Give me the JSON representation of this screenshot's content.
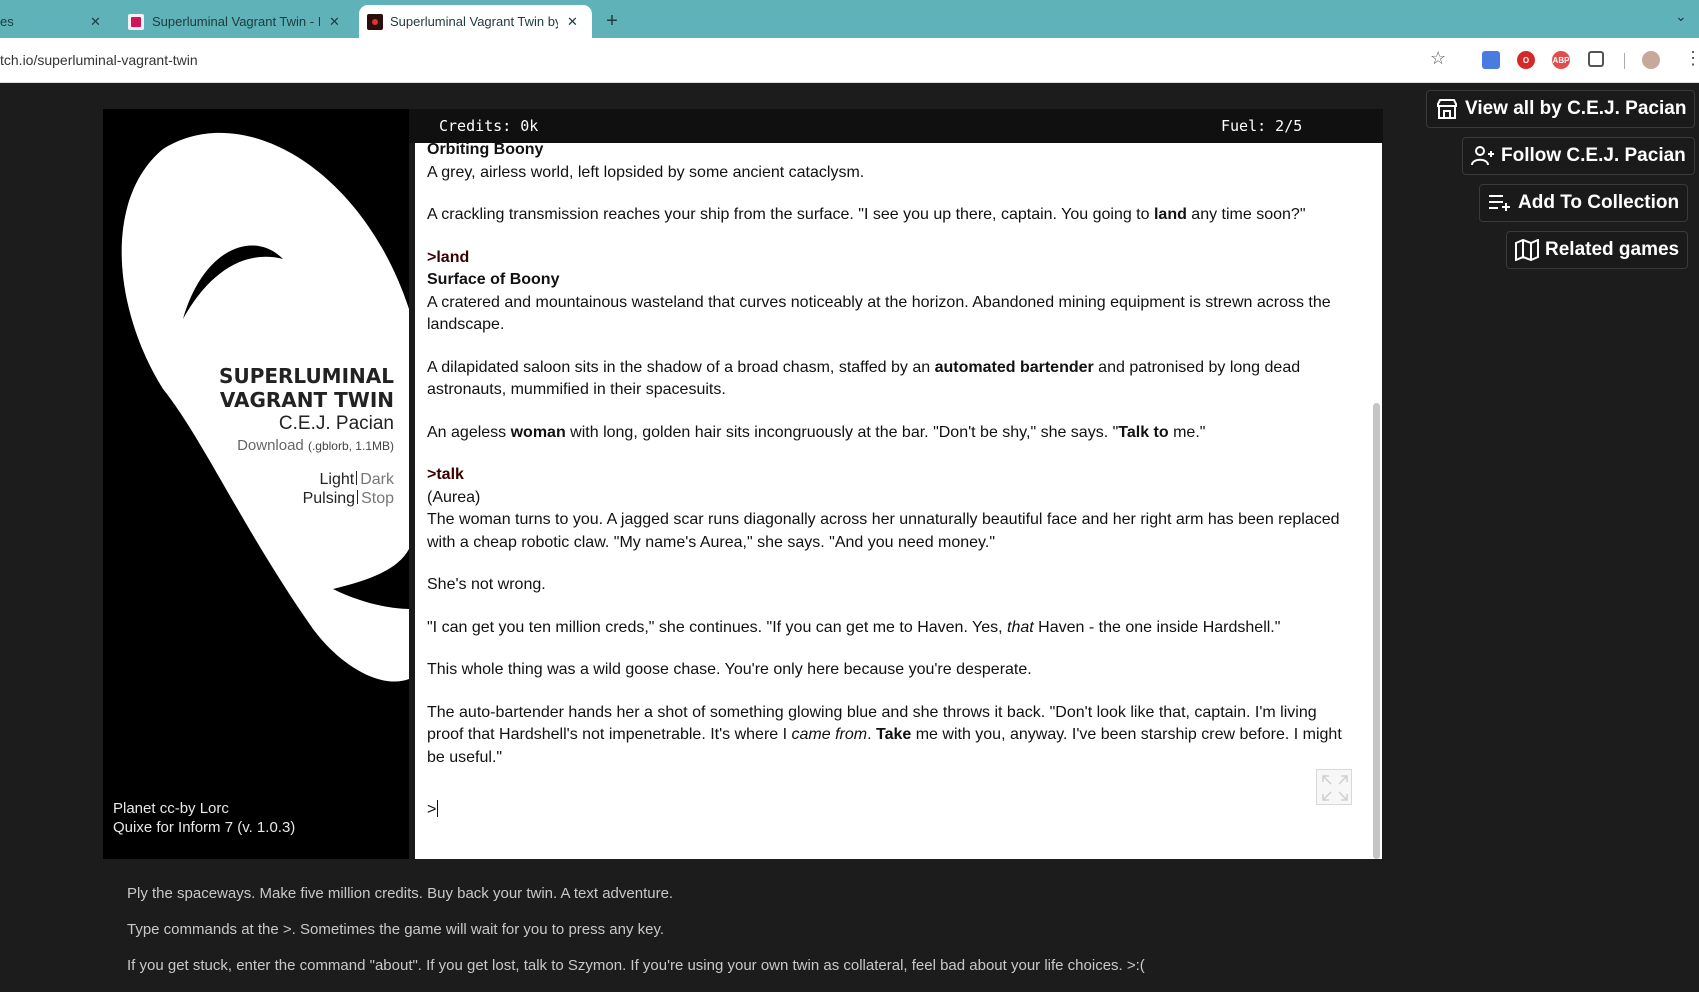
{
  "browser": {
    "tabs": [
      {
        "title": "es",
        "active": false
      },
      {
        "title": "Superluminal Vagrant Twin - I",
        "active": false
      },
      {
        "title": "Superluminal Vagrant Twin by",
        "active": true
      }
    ],
    "url": "tch.io/superluminal-vagrant-twin",
    "extensions": [
      "docs-icon",
      "opera-icon",
      "adblock-icon",
      "puzzle-icon",
      "avatar"
    ],
    "adblock_text": "ABP"
  },
  "game": {
    "cover": {
      "title_line1": "SUPERLUMINAL",
      "title_line2": "VAGRANT TWIN",
      "author": "C.E.J. Pacian",
      "download_label": "Download",
      "download_meta": "(.gblorb, 1.1MB)",
      "theme_light": "Light",
      "theme_dark": "Dark",
      "anim_pulsing": "Pulsing",
      "anim_stop": "Stop",
      "credit_line1": "Planet cc-by Lorc",
      "credit_line2": "Quixe for Inform 7 (v. 1.0.3)"
    },
    "status": {
      "credits": "Credits: 0k",
      "fuel": "Fuel: 2/5"
    },
    "transcript": {
      "heading_orbit": "Orbiting Boony",
      "p1": "A grey, airless world, left lopsided by some ancient cataclysm.",
      "p2_pre": "A crackling transmission reaches your ship from the surface. \"I see you up there, captain. You going to ",
      "p2_bold": "land",
      "p2_post": " any time soon?\"",
      "cmd_land": ">land",
      "heading_surface": "Surface of Boony",
      "p3": "A cratered and mountainous wasteland that curves noticeably at the horizon. Abandoned mining equipment is strewn across the landscape.",
      "p4_pre": "A dilapidated saloon sits in the shadow of a broad chasm, staffed by an ",
      "p4_bold": "automated bartender",
      "p4_post": " and patronised by long dead astronauts, mummified in their spacesuits.",
      "p5_pre": "An ageless ",
      "p5_bold1": "woman",
      "p5_mid": " with long, golden hair sits incongruously at the bar.  \"Don't be shy,\" she says. \"",
      "p5_bold2": "Talk to",
      "p5_post": " me.\"",
      "cmd_talk": ">talk",
      "p6_line1": "(Aurea)",
      "p6_rest": "The woman turns to you. A jagged scar runs diagonally across her unnaturally beautiful face and her right arm has been replaced with a cheap robotic claw. \"My name's Aurea,\" she says. \"And you need money.\"",
      "p7": "She's not wrong.",
      "p8_pre": "\"I can get you ten million creds,\" she continues. \"If you can get me to Haven. Yes, ",
      "p8_em": "that",
      "p8_post": " Haven - the one inside Hardshell.\"",
      "p9": "This whole thing was a wild goose chase. You're only here because you're desperate.",
      "p10_pre": "The auto-bartender hands her a shot of something glowing blue and she throws it back. \"Don't look like that, captain. I'm living proof that Hardshell's not impenetrable. It's where I ",
      "p10_em": "came from",
      "p10_mid": ". ",
      "p10_bold": "Take",
      "p10_post": " me with you, anyway. I've been starship crew before. I might be useful.\"",
      "prompt": ">"
    }
  },
  "actions": {
    "view_all": "View all by C.E.J. Pacian",
    "follow": "Follow C.E.J. Pacian",
    "add_collection": "Add To Collection",
    "related": "Related games"
  },
  "description": {
    "line1": "Ply the spaceways. Make five million credits. Buy back your twin. A text adventure.",
    "line2": "Type commands at the >. Sometimes the game will wait for you to press any key.",
    "line3": "If you get stuck, enter the command \"about\". If you get lost, talk to Szymon. If you're using your own twin as collateral, feel bad about your life choices. >:("
  }
}
